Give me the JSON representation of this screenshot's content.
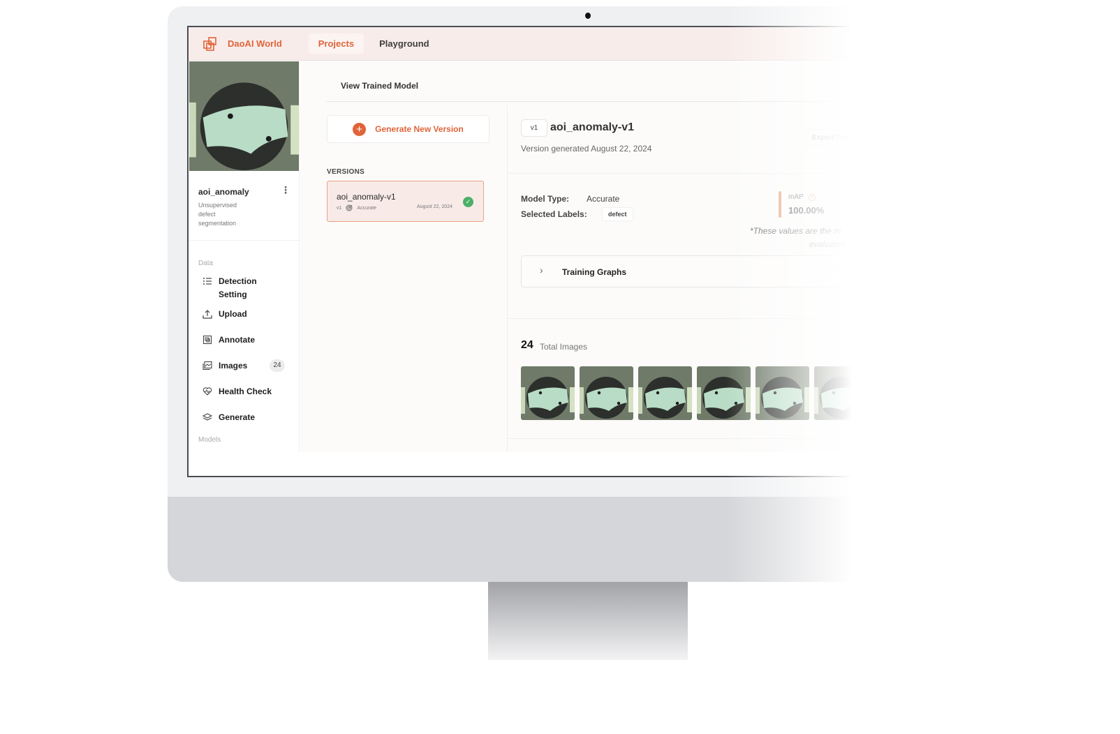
{
  "app": {
    "brand": "DaoAI World",
    "nav_tabs": [
      {
        "label": "Projects",
        "active": true
      },
      {
        "label": "Playground",
        "active": false
      }
    ],
    "accent_color": "#e0643a"
  },
  "sidebar": {
    "project_name": "aoi_anomaly",
    "project_description": "Unsupervised defect segmentation",
    "sections": [
      {
        "label": "Data"
      },
      {
        "label": "Models"
      }
    ],
    "items": [
      {
        "label": "Detection Setting",
        "icon": "list-icon"
      },
      {
        "label": "Upload",
        "icon": "upload-icon"
      },
      {
        "label": "Annotate",
        "icon": "annotate-icon"
      },
      {
        "label": "Images",
        "icon": "images-icon",
        "badge": "24"
      },
      {
        "label": "Health Check",
        "icon": "heart-icon"
      },
      {
        "label": "Generate",
        "icon": "layers-icon"
      }
    ]
  },
  "main": {
    "view_title": "View Trained Model",
    "generate_button": "Generate New Version",
    "versions_label": "VERSIONS",
    "versions": [
      {
        "name": "aoi_anomaly-v1",
        "tag": "v1",
        "type": "Accurate",
        "date": "August 22, 2024",
        "status": "complete"
      }
    ],
    "detail": {
      "version_pill": "v1",
      "title": "aoi_anomaly-v1",
      "subtitle": "Version generated August 22, 2024",
      "export_button": "Export Trai",
      "model_type_label": "Model Type:",
      "model_type_value": "Accurate",
      "selected_labels_label": "Selected Labels:",
      "selected_labels": [
        "defect"
      ],
      "metric_label": "mAP",
      "metric_value": "100.00%",
      "note_line1": "*These values are the m",
      "note_line2": "evaluated",
      "training_graphs_label": "Training Graphs",
      "total_images_count": "24",
      "total_images_label": "Total Images",
      "thumbnail_count_visible": 6
    }
  }
}
